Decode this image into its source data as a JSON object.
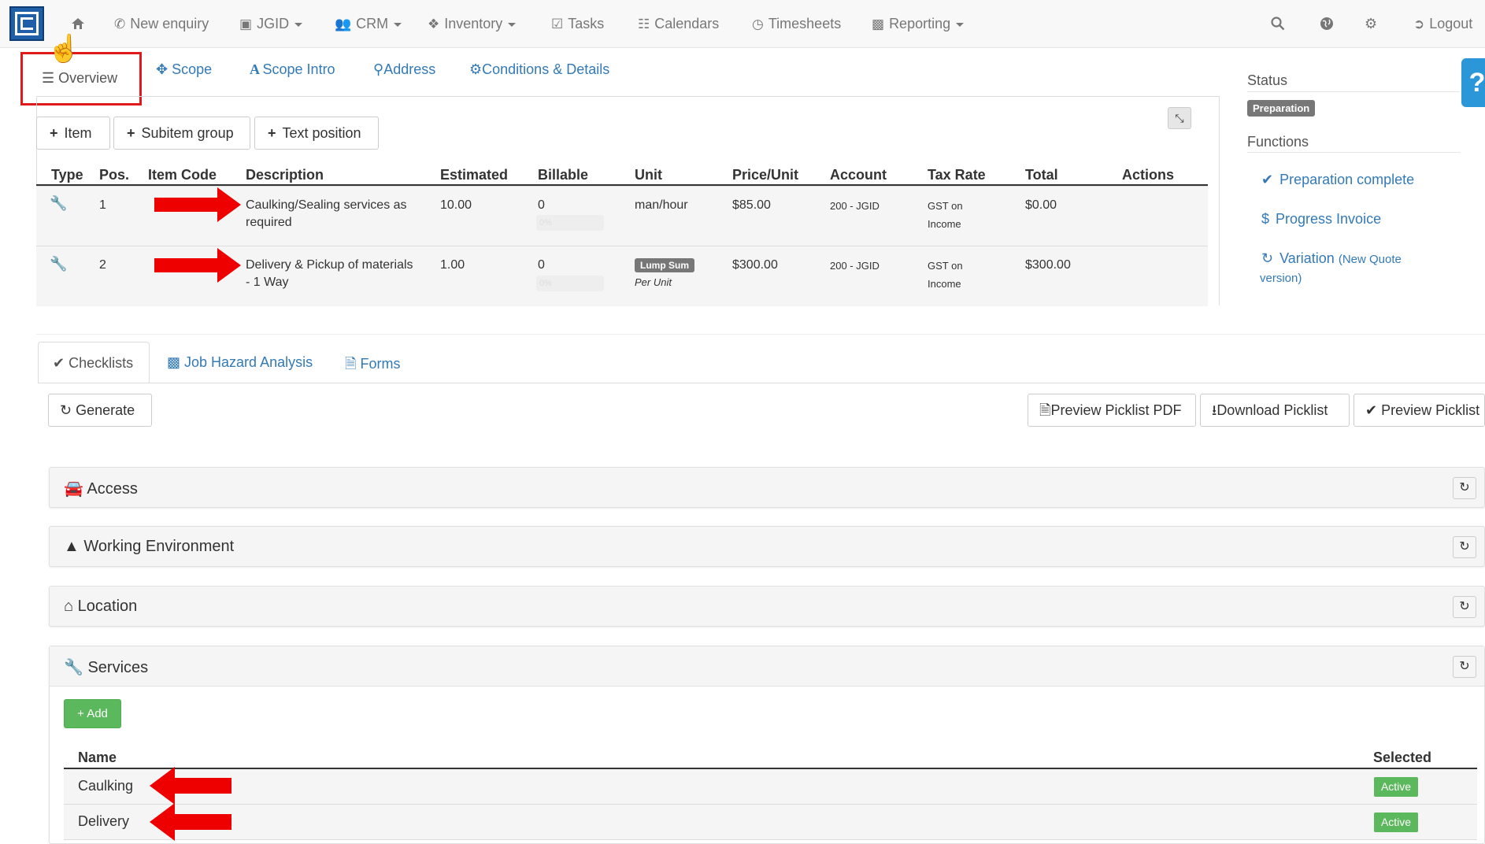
{
  "navbar": {
    "new_enquiry": "New enquiry",
    "jgid": "JGID",
    "crm": "CRM",
    "inventory": "Inventory",
    "tasks": "Tasks",
    "calendars": "Calendars",
    "timesheets": "Timesheets",
    "reporting": "Reporting",
    "logout": "Logout"
  },
  "tabs": {
    "overview": "Overview",
    "scope": "Scope",
    "scope_intro": "Scope Intro",
    "address": "Address",
    "conditions": "Conditions & Details"
  },
  "toolbar": {
    "item": "Item",
    "subitem_group": "Subitem group",
    "text_position": "Text position"
  },
  "table": {
    "headers": [
      "Type",
      "Pos.",
      "Item Code",
      "Description",
      "Estimated",
      "Billable",
      "Unit",
      "Price/Unit",
      "Account",
      "Tax Rate",
      "Total",
      "Actions"
    ],
    "rows": [
      {
        "pos": "1",
        "desc1": "Caulking/Sealing services as",
        "desc2": "required",
        "estimated": "10.00",
        "billable": "0",
        "progress": "0%",
        "unit": "man/hour",
        "price": "$85.00",
        "account": "200 - JGID",
        "tax1": "GST on",
        "tax2": "Income",
        "total": "$0.00"
      },
      {
        "pos": "2",
        "desc1": "Delivery & Pickup of materials",
        "desc2": "- 1 Way",
        "estimated": "1.00",
        "billable": "0",
        "progress": "0%",
        "unit_badge": "Lump Sum",
        "unit_sub": "Per Unit",
        "price": "$300.00",
        "account": "200 - JGID",
        "tax1": "GST on",
        "tax2": "Income",
        "total": "$300.00"
      }
    ]
  },
  "sidebar": {
    "status_label": "Status",
    "status_badge": "Preparation",
    "functions_label": "Functions",
    "preparation_complete": "Preparation complete",
    "progress_invoice": "Progress Invoice",
    "variation": "Variation",
    "variation_note1": "(New Quote",
    "variation_note2": "version)",
    "help": "?"
  },
  "lower": {
    "tabs": {
      "checklists": "Checklists",
      "jha": "Job Hazard Analysis",
      "forms": "Forms"
    },
    "generate": "Generate",
    "preview_pdf": "Preview Picklist PDF",
    "download": "Download Picklist",
    "preview": "Preview Picklist",
    "sections": {
      "access": "Access",
      "working_env": "Working Environment",
      "location": "Location",
      "services": "Services"
    },
    "add": "Add",
    "services_headers": {
      "name": "Name",
      "selected": "Selected"
    },
    "services_rows": [
      {
        "name": "Caulking",
        "selected": "Active"
      },
      {
        "name": "Delivery",
        "selected": "Active"
      }
    ]
  },
  "colors": {
    "link": "#337ab7",
    "highlight_box": "#e01a1a",
    "arrow": "#ee0000",
    "success": "#5cb85c",
    "help": "#2b96d8"
  }
}
